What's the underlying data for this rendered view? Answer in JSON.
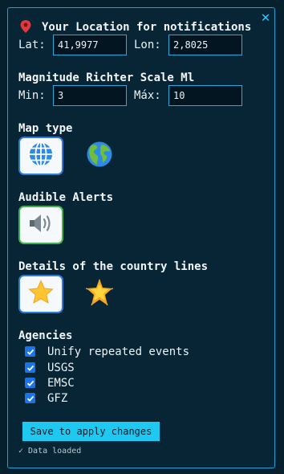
{
  "location": {
    "pin_icon": "pin-icon",
    "title": "Your Location for notifications",
    "lat_label": "Lat:",
    "lat_value": "41,9977",
    "lon_label": "Lon:",
    "lon_value": "2,8025"
  },
  "magnitude": {
    "title": "Magnitude Richter Scale Ml",
    "min_label": "Min:",
    "min_value": "3",
    "max_label": "Máx:",
    "max_value": "10"
  },
  "map_type": {
    "title": "Map type",
    "options": [
      "globe-meridians-icon",
      "globe-earth-icon"
    ]
  },
  "audible_alerts": {
    "title": "Audible Alerts",
    "icon": "speaker-icon"
  },
  "country_lines": {
    "title": "Details of the country lines",
    "options": [
      "star-icon",
      "glowing-star-icon"
    ]
  },
  "agencies": {
    "title": "Agencies",
    "items": [
      {
        "label": "Unify repeated events",
        "checked": true
      },
      {
        "label": "USGS",
        "checked": true
      },
      {
        "label": "EMSC",
        "checked": true
      },
      {
        "label": "GFZ",
        "checked": true
      }
    ]
  },
  "save_button": "Save to apply changes",
  "status": "✓ Data loaded",
  "colors": {
    "background": "#06202e",
    "border": "#1f9fd8",
    "accent": "#1ec8f0",
    "close": "#30c8ff",
    "checkbox": "#1a73e8"
  }
}
